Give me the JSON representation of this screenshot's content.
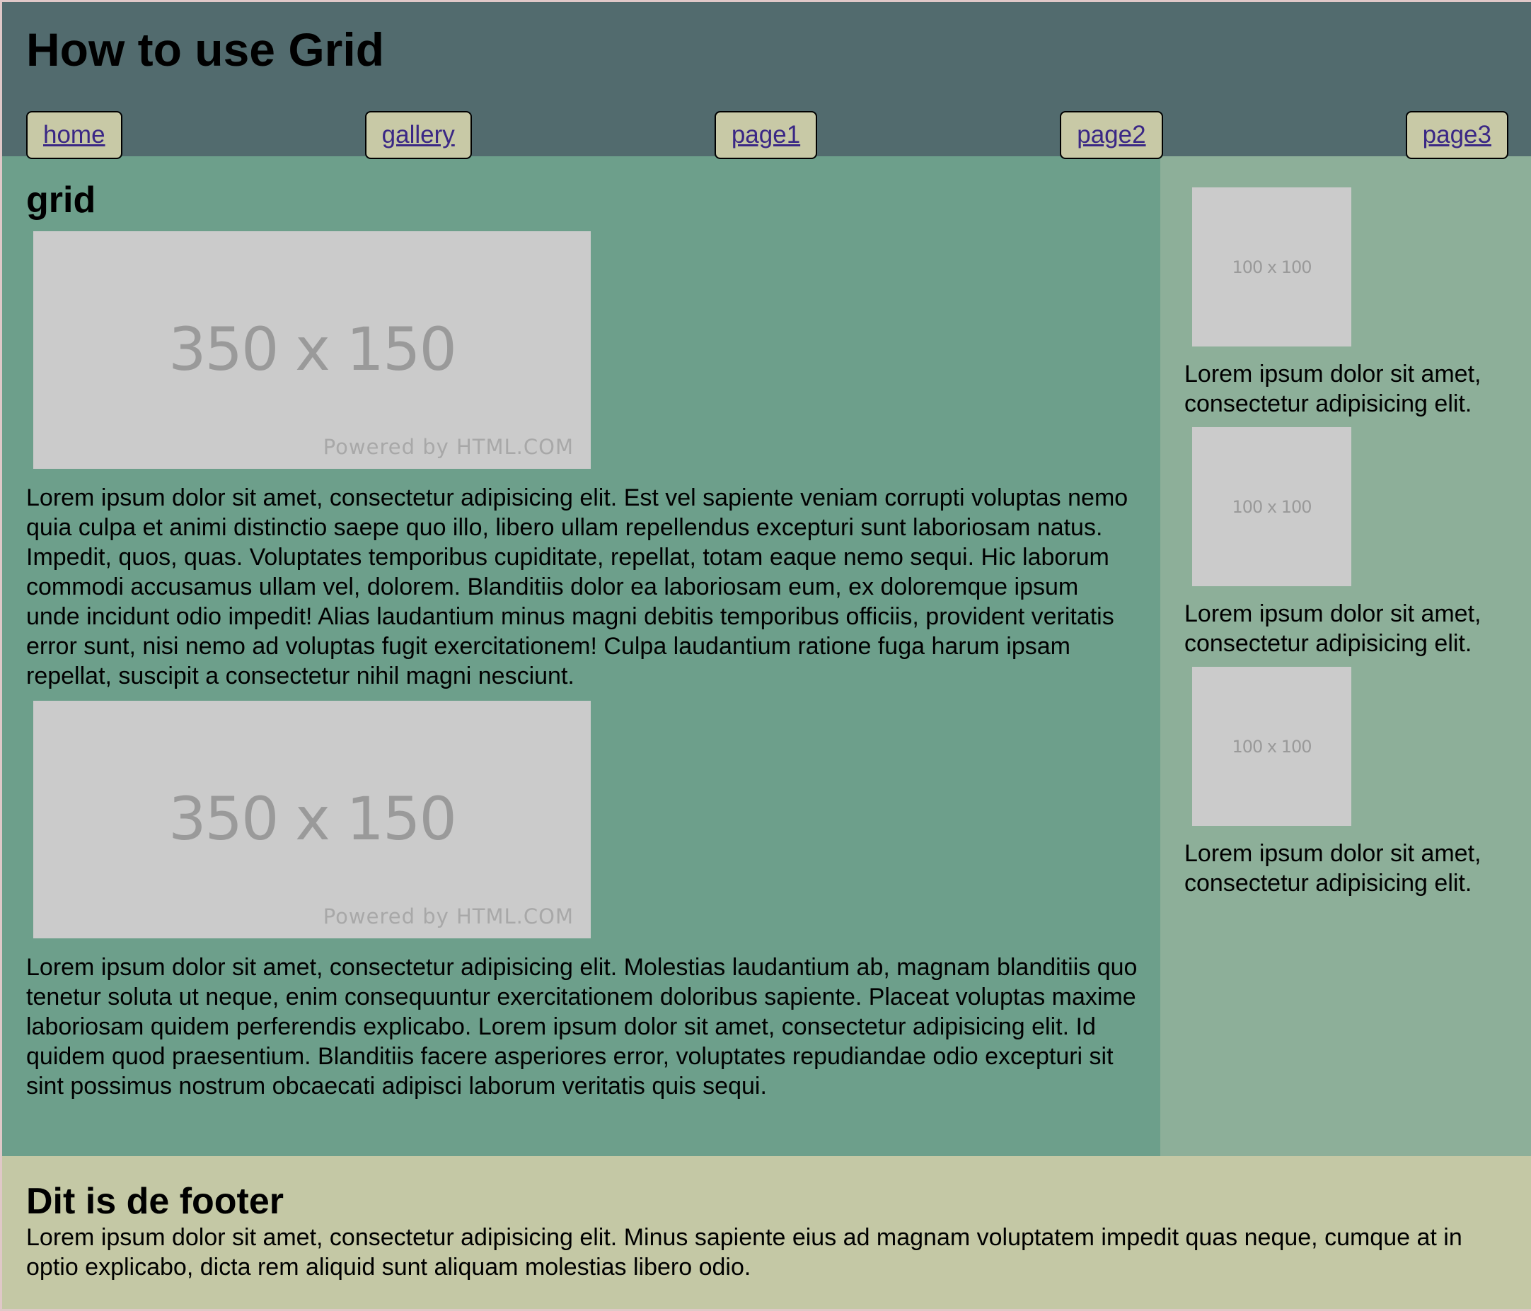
{
  "header": {
    "title": "How to use Grid",
    "nav": [
      {
        "label": "home"
      },
      {
        "label": "gallery"
      },
      {
        "label": "page1"
      },
      {
        "label": "page2"
      },
      {
        "label": "page3"
      }
    ]
  },
  "main": {
    "heading": "grid",
    "images": [
      {
        "dims": "350 x 150",
        "powered": "Powered by HTML.COM"
      },
      {
        "dims": "350 x 150",
        "powered": "Powered by HTML.COM"
      }
    ],
    "paragraphs": [
      "Lorem ipsum dolor sit amet, consectetur adipisicing elit. Est vel sapiente veniam corrupti voluptas nemo quia culpa et animi distinctio saepe quo illo, libero ullam repellendus excepturi sunt laboriosam natus. Impedit, quos, quas. Voluptates temporibus cupiditate, repellat, totam eaque nemo sequi. Hic laborum commodi accusamus ullam vel, dolorem. Blanditiis dolor ea laboriosam eum, ex doloremque ipsum unde incidunt odio impedit! Alias laudantium minus magni debitis temporibus officiis, provident veritatis error sunt, nisi nemo ad voluptas fugit exercitationem! Culpa laudantium ratione fuga harum ipsam repellat, suscipit a consectetur nihil magni nesciunt.",
      "Lorem ipsum dolor sit amet, consectetur adipisicing elit. Molestias laudantium ab, magnam blanditiis quo tenetur soluta ut neque, enim consequuntur exercitationem doloribus sapiente. Placeat voluptas maxime laboriosam quidem perferendis explicabo. Lorem ipsum dolor sit amet, consectetur adipisicing elit. Id quidem quod praesentium. Blanditiis facere asperiores error, voluptates repudiandae odio excepturi sit sint possimus nostrum obcaecati adipisci laborum veritatis quis sequi."
    ]
  },
  "aside": {
    "cards": [
      {
        "dims": "100 x 100",
        "line1": "Lorem ipsum dolor sit amet,",
        "line2": "consectetur adipisicing elit."
      },
      {
        "dims": "100 x 100",
        "line1": "Lorem ipsum dolor sit amet,",
        "line2": "consectetur adipisicing elit."
      },
      {
        "dims": "100 x 100",
        "line1": "Lorem ipsum dolor sit amet,",
        "line2": "consectetur adipisicing elit."
      }
    ]
  },
  "footer": {
    "heading": "Dit is de footer",
    "text": "Lorem ipsum dolor sit amet, consectetur adipisicing elit. Minus sapiente eius ad magnam voluptatem impedit quas neque, cumque at in optio explicabo, dicta rem aliquid sunt aliquam molestias libero odio."
  }
}
